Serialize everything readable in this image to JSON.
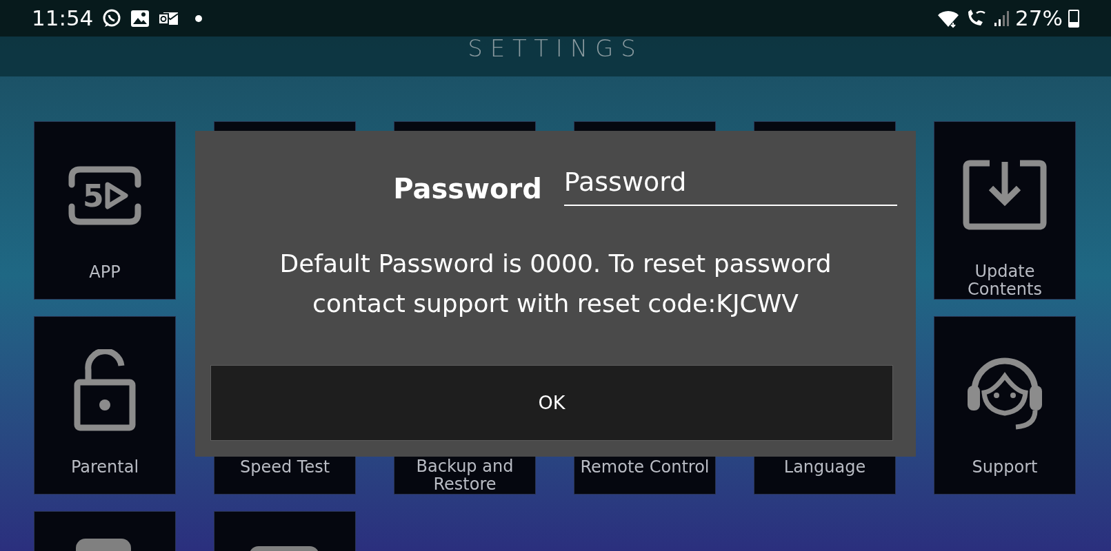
{
  "status_bar": {
    "time": "11:54",
    "battery": "27%"
  },
  "header": {
    "title": "SETTINGS"
  },
  "tiles": [
    {
      "kind": "app",
      "label": "APP",
      "icon_text": "5"
    },
    {
      "kind": "hidden"
    },
    {
      "kind": "hidden"
    },
    {
      "kind": "hidden"
    },
    {
      "kind": "hidden"
    },
    {
      "kind": "download",
      "label": "Update Contents"
    },
    {
      "kind": "lock",
      "label": "Parental"
    },
    {
      "kind": "blank",
      "label": "Speed Test"
    },
    {
      "kind": "blank",
      "label": "Backup and Restore"
    },
    {
      "kind": "blank",
      "label": "Remote Control"
    },
    {
      "kind": "blank",
      "label": "Language"
    },
    {
      "kind": "headset",
      "label": "Support"
    },
    {
      "kind": "cut-a"
    },
    {
      "kind": "cut-b"
    }
  ],
  "dialog": {
    "label": "Password",
    "field": {
      "placeholder": "Password"
    },
    "message": "Default Password is 0000. To reset password contact support with reset code:KJCWV",
    "button": "OK"
  }
}
